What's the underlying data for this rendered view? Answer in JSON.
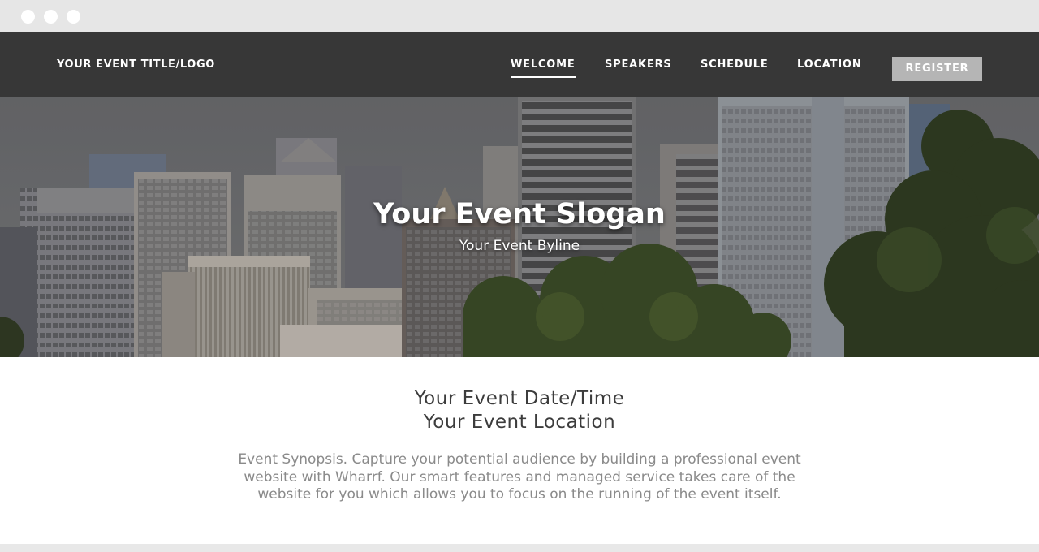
{
  "nav": {
    "brand": "YOUR EVENT TITLE/LOGO",
    "items": [
      {
        "label": "WELCOME",
        "active": true
      },
      {
        "label": "SPEAKERS",
        "active": false
      },
      {
        "label": "SCHEDULE",
        "active": false
      },
      {
        "label": "LOCATION",
        "active": false
      }
    ],
    "register_label": "REGISTER"
  },
  "hero": {
    "slogan": "Your Event Slogan",
    "byline": "Your Event Byline"
  },
  "info": {
    "date_time": "Your Event Date/Time",
    "location": "Your Event Location",
    "synopsis": "Event Synopsis. Capture your potential audience by building a professional event website with Wharrf. Our smart features and managed service takes care of the website for you which allows you to focus on the running of the event itself."
  },
  "colors": {
    "nav_bg": "#373737",
    "register_bg": "#b5b5b5",
    "chrome_bg": "#e6e6e6",
    "heading_text": "#3c3c3c",
    "synopsis_text": "#8a8a8a"
  }
}
